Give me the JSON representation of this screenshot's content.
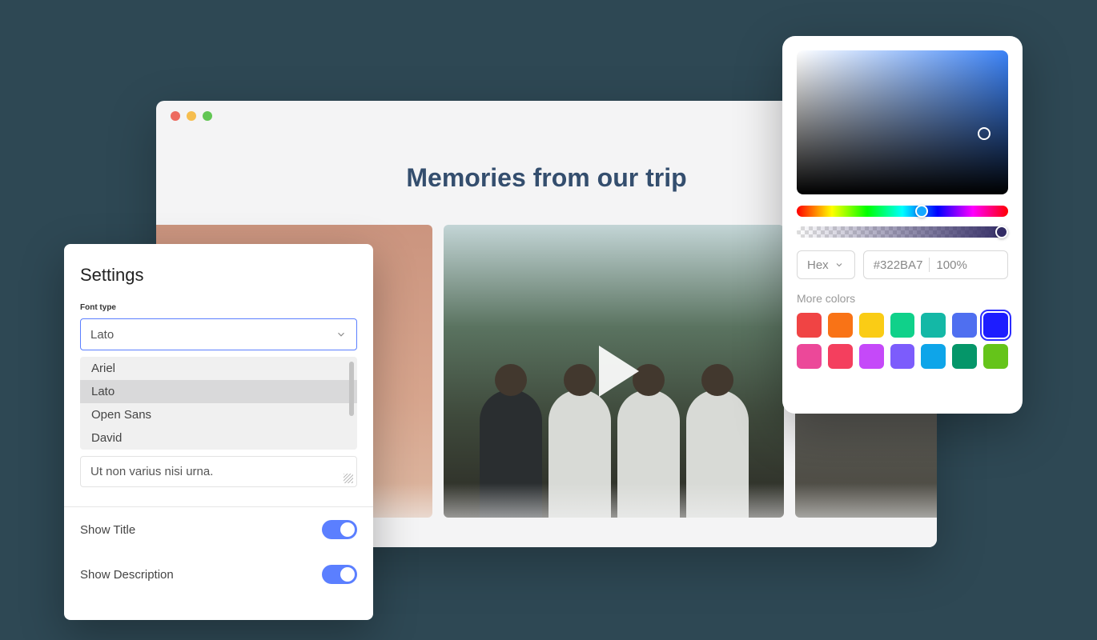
{
  "browser": {
    "page_title": "Memories from our trip"
  },
  "settings": {
    "panel_title": "Settings",
    "font_type_label": "Font type",
    "font_selected": "Lato",
    "font_options": [
      "Ariel",
      "Lato",
      "Open Sans",
      "David"
    ],
    "sample_text": "Ut non varius nisi urna.",
    "toggles": [
      {
        "label": "Show Title",
        "value": true
      },
      {
        "label": "Show Description",
        "value": true
      }
    ]
  },
  "color_picker": {
    "format_label": "Hex",
    "hex_value": "#322BA7",
    "opacity": "100%",
    "more_colors_label": "More colors",
    "swatches": [
      {
        "color": "#F04444",
        "selected": false
      },
      {
        "color": "#F97316",
        "selected": false
      },
      {
        "color": "#FACC15",
        "selected": false
      },
      {
        "color": "#10D18A",
        "selected": false
      },
      {
        "color": "#14B8A6",
        "selected": false
      },
      {
        "color": "#4F6FF0",
        "selected": false
      },
      {
        "color": "#1D1DFF",
        "selected": true
      },
      {
        "color": "#EC4899",
        "selected": false
      },
      {
        "color": "#F43F5E",
        "selected": false
      },
      {
        "color": "#C549F9",
        "selected": false
      },
      {
        "color": "#7C5CFC",
        "selected": false
      },
      {
        "color": "#0EA5E9",
        "selected": false
      },
      {
        "color": "#059669",
        "selected": false
      },
      {
        "color": "#65C41A",
        "selected": false
      }
    ]
  }
}
